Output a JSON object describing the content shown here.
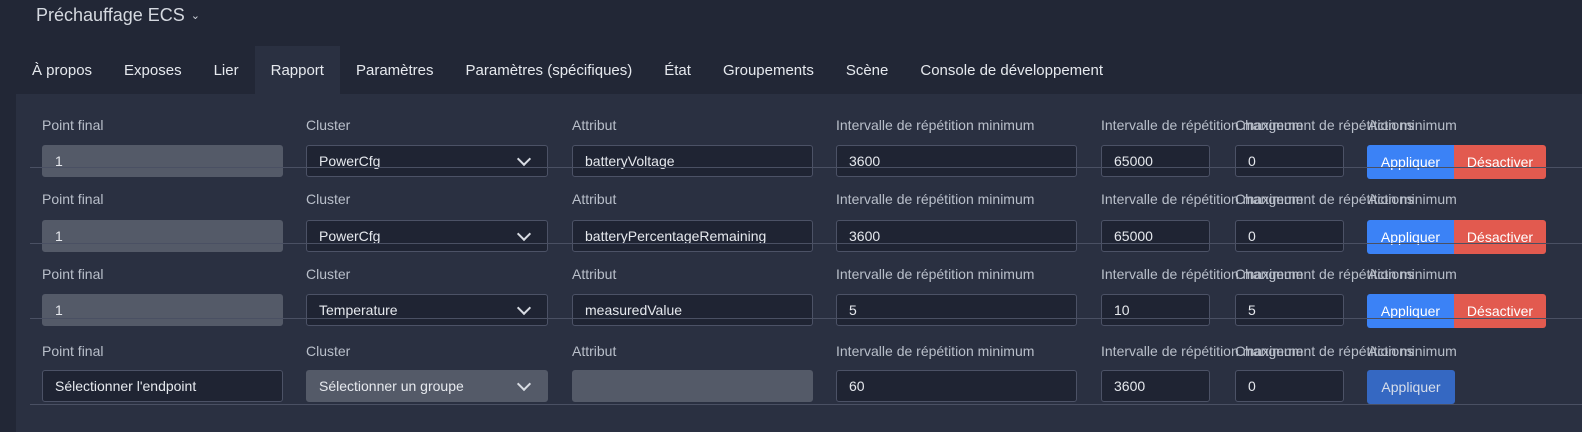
{
  "header": {
    "title": "Préchauffage ECS"
  },
  "tabs": [
    {
      "label": "À propos"
    },
    {
      "label": "Exposes"
    },
    {
      "label": "Lier"
    },
    {
      "label": "Rapport",
      "active": true
    },
    {
      "label": "Paramètres"
    },
    {
      "label": "Paramètres (spécifiques)"
    },
    {
      "label": "État"
    },
    {
      "label": "Groupements"
    },
    {
      "label": "Scène"
    },
    {
      "label": "Console de développement"
    }
  ],
  "labels": {
    "endpoint": "Point final",
    "cluster": "Cluster",
    "attribute": "Attribut",
    "min_interval": "Intervalle de répétition minimum",
    "max_interval": "Intervalle de répétition maximum",
    "min_change": "Changement de répétition minimum",
    "actions": "Actions",
    "apply": "Appliquer",
    "disable": "Désactiver"
  },
  "rows": [
    {
      "endpoint": "1",
      "cluster": "PowerCfg",
      "attribute": "batteryVoltage",
      "min": "3600",
      "max": "65000",
      "change": "0"
    },
    {
      "endpoint": "1",
      "cluster": "PowerCfg",
      "attribute": "batteryPercentageRemaining",
      "min": "3600",
      "max": "65000",
      "change": "0"
    },
    {
      "endpoint": "1",
      "cluster": "Temperature",
      "attribute": "measuredValue",
      "min": "5",
      "max": "10",
      "change": "5"
    },
    {
      "endpoint": "Sélectionner l'endpoint",
      "cluster": "Sélectionner un groupe",
      "attribute": "",
      "min": "60",
      "max": "3600",
      "change": "0"
    }
  ]
}
